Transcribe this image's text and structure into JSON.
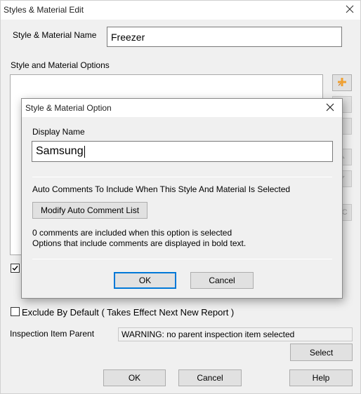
{
  "window": {
    "title": "Styles & Material Edit",
    "name_label": "Style & Material Name",
    "name_value": "Freezer",
    "options_label": "Style and Material Options",
    "exclude_label": "Exclude By Default ( Takes Effect Next New Report )",
    "exclude_checked": false,
    "partial_checkbox_checked": true,
    "parent_label": "Inspection Item Parent",
    "parent_value": "WARNING: no parent inspection item selected",
    "select_label": "Select",
    "ok_label": "OK",
    "cancel_label": "Cancel",
    "help_label": "Help",
    "side_buttons": [
      {
        "icon": "add-icon"
      },
      {
        "icon": "edit-icon"
      },
      {
        "icon": "delete-icon"
      },
      {
        "icon": "move-up-icon"
      },
      {
        "icon": "move-down-icon"
      },
      {
        "icon": "abc-icon",
        "text": "BC"
      }
    ],
    "add_icon_color": "#f0a030"
  },
  "dialog": {
    "title": "Style & Material Option",
    "display_name_label": "Display Name",
    "display_name_value": "Samsung",
    "auto_comments_heading": "Auto Comments To Include When This Style And Material Is Selected",
    "modify_button_label": "Modify Auto Comment List",
    "info_line1": "0 comments are included when this option is selected",
    "info_line2": "Options that include comments are displayed in bold text.",
    "ok_label": "OK",
    "cancel_label": "Cancel"
  }
}
